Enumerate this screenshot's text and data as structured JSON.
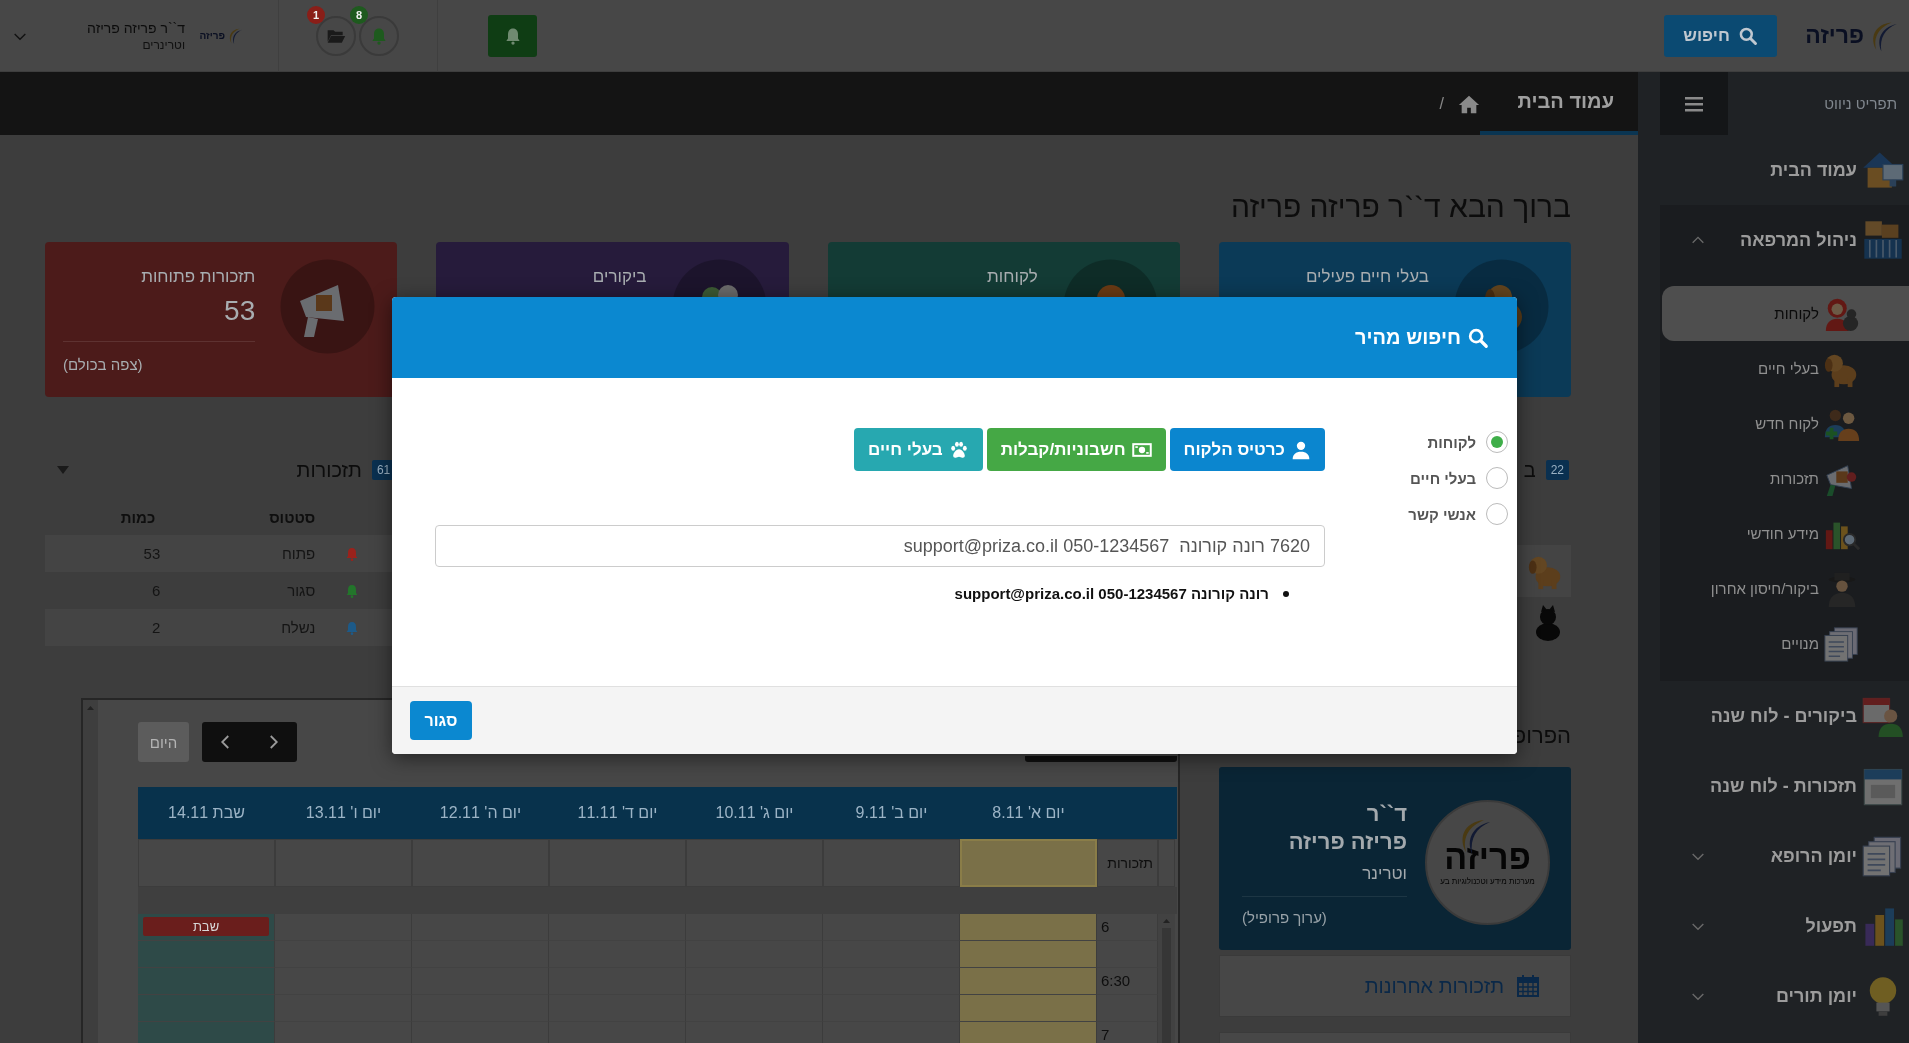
{
  "top_bar": {
    "logo": "פריזה",
    "search_button": "חיפוש",
    "notifications": [
      {
        "count": "8",
        "color": "#1e5a1e"
      },
      {
        "count": "1",
        "color": "#8a1e18"
      }
    ],
    "user": {
      "logo": "פריזה",
      "name": "ד``ר פריזה פריזה",
      "role": "וטרינרים"
    }
  },
  "sidebar": {
    "title": "תפריט ניווט",
    "items": [
      {
        "label": "עמוד הבית"
      },
      {
        "label": "ניהול המרפאה",
        "expanded": true,
        "children": [
          {
            "label": "לקוחות",
            "selected": true
          },
          {
            "label": "בעלי חיים",
            "selected": false
          },
          {
            "label": "לקוח חדש",
            "selected": false
          },
          {
            "label": "תזכורות",
            "selected": false
          },
          {
            "label": "מידע חודשי",
            "selected": false
          },
          {
            "label": "ביקור/חיסון אחרון",
            "selected": false
          },
          {
            "label": "מנויים",
            "selected": false
          }
        ]
      },
      {
        "label": "ביקורים - לוח שנה"
      },
      {
        "label": "תזכורות - לוח שנה"
      },
      {
        "label": "יומן הרופא",
        "expanded": false
      },
      {
        "label": "תפעול",
        "expanded": false
      },
      {
        "label": "יומן תורים",
        "expanded": false
      }
    ]
  },
  "breadcrumb": {
    "title": "עמוד הבית",
    "separator": "/"
  },
  "welcome": "ברוך הבא ד``ר פריזה פריזה",
  "stat_cards": [
    {
      "title": "בעלי חיים פעילים",
      "color": "#0b3a57"
    },
    {
      "title": "לקוחות",
      "color": "#133b35"
    },
    {
      "title": "ביקורים",
      "color": "#261b3b"
    },
    {
      "title": "תזכורות פתוחות",
      "value": "53",
      "link": "(צפה בכולם)",
      "color": "#4c1b1a"
    }
  ],
  "reminders_panel": {
    "title": "תזכורות",
    "count": "61",
    "columns": [
      "סטטוס",
      "כמות"
    ],
    "rows": [
      {
        "status": "פתוח",
        "count": "53",
        "color": "#9a221c"
      },
      {
        "status": "סגור",
        "count": "6",
        "color": "#23752b"
      },
      {
        "status": "נשלח",
        "count": "2",
        "color": "#1d5a88"
      }
    ]
  },
  "animals_panel": {
    "title": "ב",
    "count": "22"
  },
  "calendar": {
    "today_button": "היום",
    "reminders_label": "תזכורות",
    "times": [
      "6",
      "6:30",
      "7"
    ],
    "days": [
      {
        "label": "יום א' 8.11",
        "today": true,
        "weekend": false
      },
      {
        "label": "יום ב' 9.11",
        "today": false,
        "weekend": false
      },
      {
        "label": "יום ג' 10.11",
        "today": false,
        "weekend": false
      },
      {
        "label": "יום ד' 11.11",
        "today": false,
        "weekend": false
      },
      {
        "label": "יום ה' 12.11",
        "today": false,
        "weekend": false
      },
      {
        "label": "יום ו' 13.11",
        "today": false,
        "weekend": false
      },
      {
        "label": "שבת 14.11",
        "today": false,
        "weekend": true,
        "tag": "שבת"
      }
    ]
  },
  "profile": {
    "heading": "הפרופ",
    "logo": "פריזה",
    "logo_tagline": "מערכות מידע וטכנולוגיות בע",
    "title": "ד``ר",
    "name": "פריזה פריזה",
    "role": "וטרינר",
    "edit_link": "(ערוך פרופיל)",
    "recent": "תזכורות אחרונות"
  },
  "search_modal": {
    "title": "חיפוש מהיר",
    "search_types": [
      {
        "label": "לקוחות",
        "selected": true
      },
      {
        "label": "בעלי חיים",
        "selected": false
      },
      {
        "label": "אנשי קשר",
        "selected": false
      }
    ],
    "actions": [
      {
        "label": "כרטיס הלקוח",
        "color": "#0b86cf"
      },
      {
        "label": "חשבוניות/קבלות",
        "color": "#45a845"
      },
      {
        "label": "בעלי חיים",
        "color": "#27a8b0"
      }
    ],
    "query": "7620 רונה קורונה  050-1234567 support@priza.co.il",
    "results": [
      "רונה קורונה 050-1234567 support@priza.co.il"
    ],
    "close_button": "סגור"
  }
}
